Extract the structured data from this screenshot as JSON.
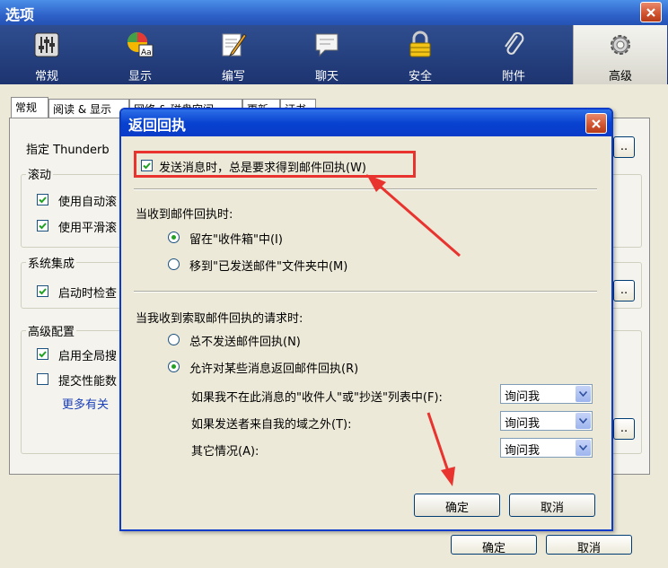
{
  "window": {
    "title": "选项"
  },
  "toolbar": {
    "items": [
      {
        "label": "常规",
        "icon": "sliders-icon"
      },
      {
        "label": "显示",
        "icon": "palette-icon"
      },
      {
        "label": "编写",
        "icon": "pencil-icon"
      },
      {
        "label": "聊天",
        "icon": "chat-bubble-icon"
      },
      {
        "label": "安全",
        "icon": "lock-icon"
      },
      {
        "label": "附件",
        "icon": "paperclip-icon"
      },
      {
        "label": "高级",
        "icon": "gear-icon"
      }
    ],
    "active": "高级"
  },
  "outer": {
    "tabs": [
      "常规",
      "阅读 & 显示",
      "网络 & 磁盘空间",
      "更新",
      "证书"
    ],
    "line1": "指定 Thunderb",
    "scroll_group": "滚动",
    "cb_auto": "使用自动滚",
    "cb_smooth": "使用平滑滚",
    "system_group": "系统集成",
    "cb_startup": "启动时检查",
    "advanced_group": "高级配置",
    "cb_global": "启用全局搜",
    "cb_perf": "提交性能数",
    "more_link": "更多有关",
    "ok_label": "确定",
    "cancel_label": "取消"
  },
  "dialog": {
    "title": "返回回执",
    "always_request": "发送消息时，总是要求得到邮件回执(W)",
    "when_receive_label": "当收到邮件回执时:",
    "keep_in_inbox": "留在\"收件箱\"中(I)",
    "move_to_sent": "移到\"已发送邮件\"文件夹中(M)",
    "when_request_label": "当我收到索取邮件回执的请求时:",
    "never_send": "总不发送邮件回执(N)",
    "allow_some": "允许对某些消息返回邮件回执(R)",
    "not_in_to_cc": "如果我不在此消息的\"收件人\"或\"抄送\"列表中(F):",
    "outside_domain": "如果发送者来自我的域之外(T):",
    "otherwise": "其它情况(A):",
    "select_value": "询问我",
    "ok_label": "确定",
    "cancel_label": "取消"
  },
  "colors": {
    "titlebar": "#0a3bc9",
    "highlight": "#e8332e",
    "radio_dot": "#21a121"
  }
}
